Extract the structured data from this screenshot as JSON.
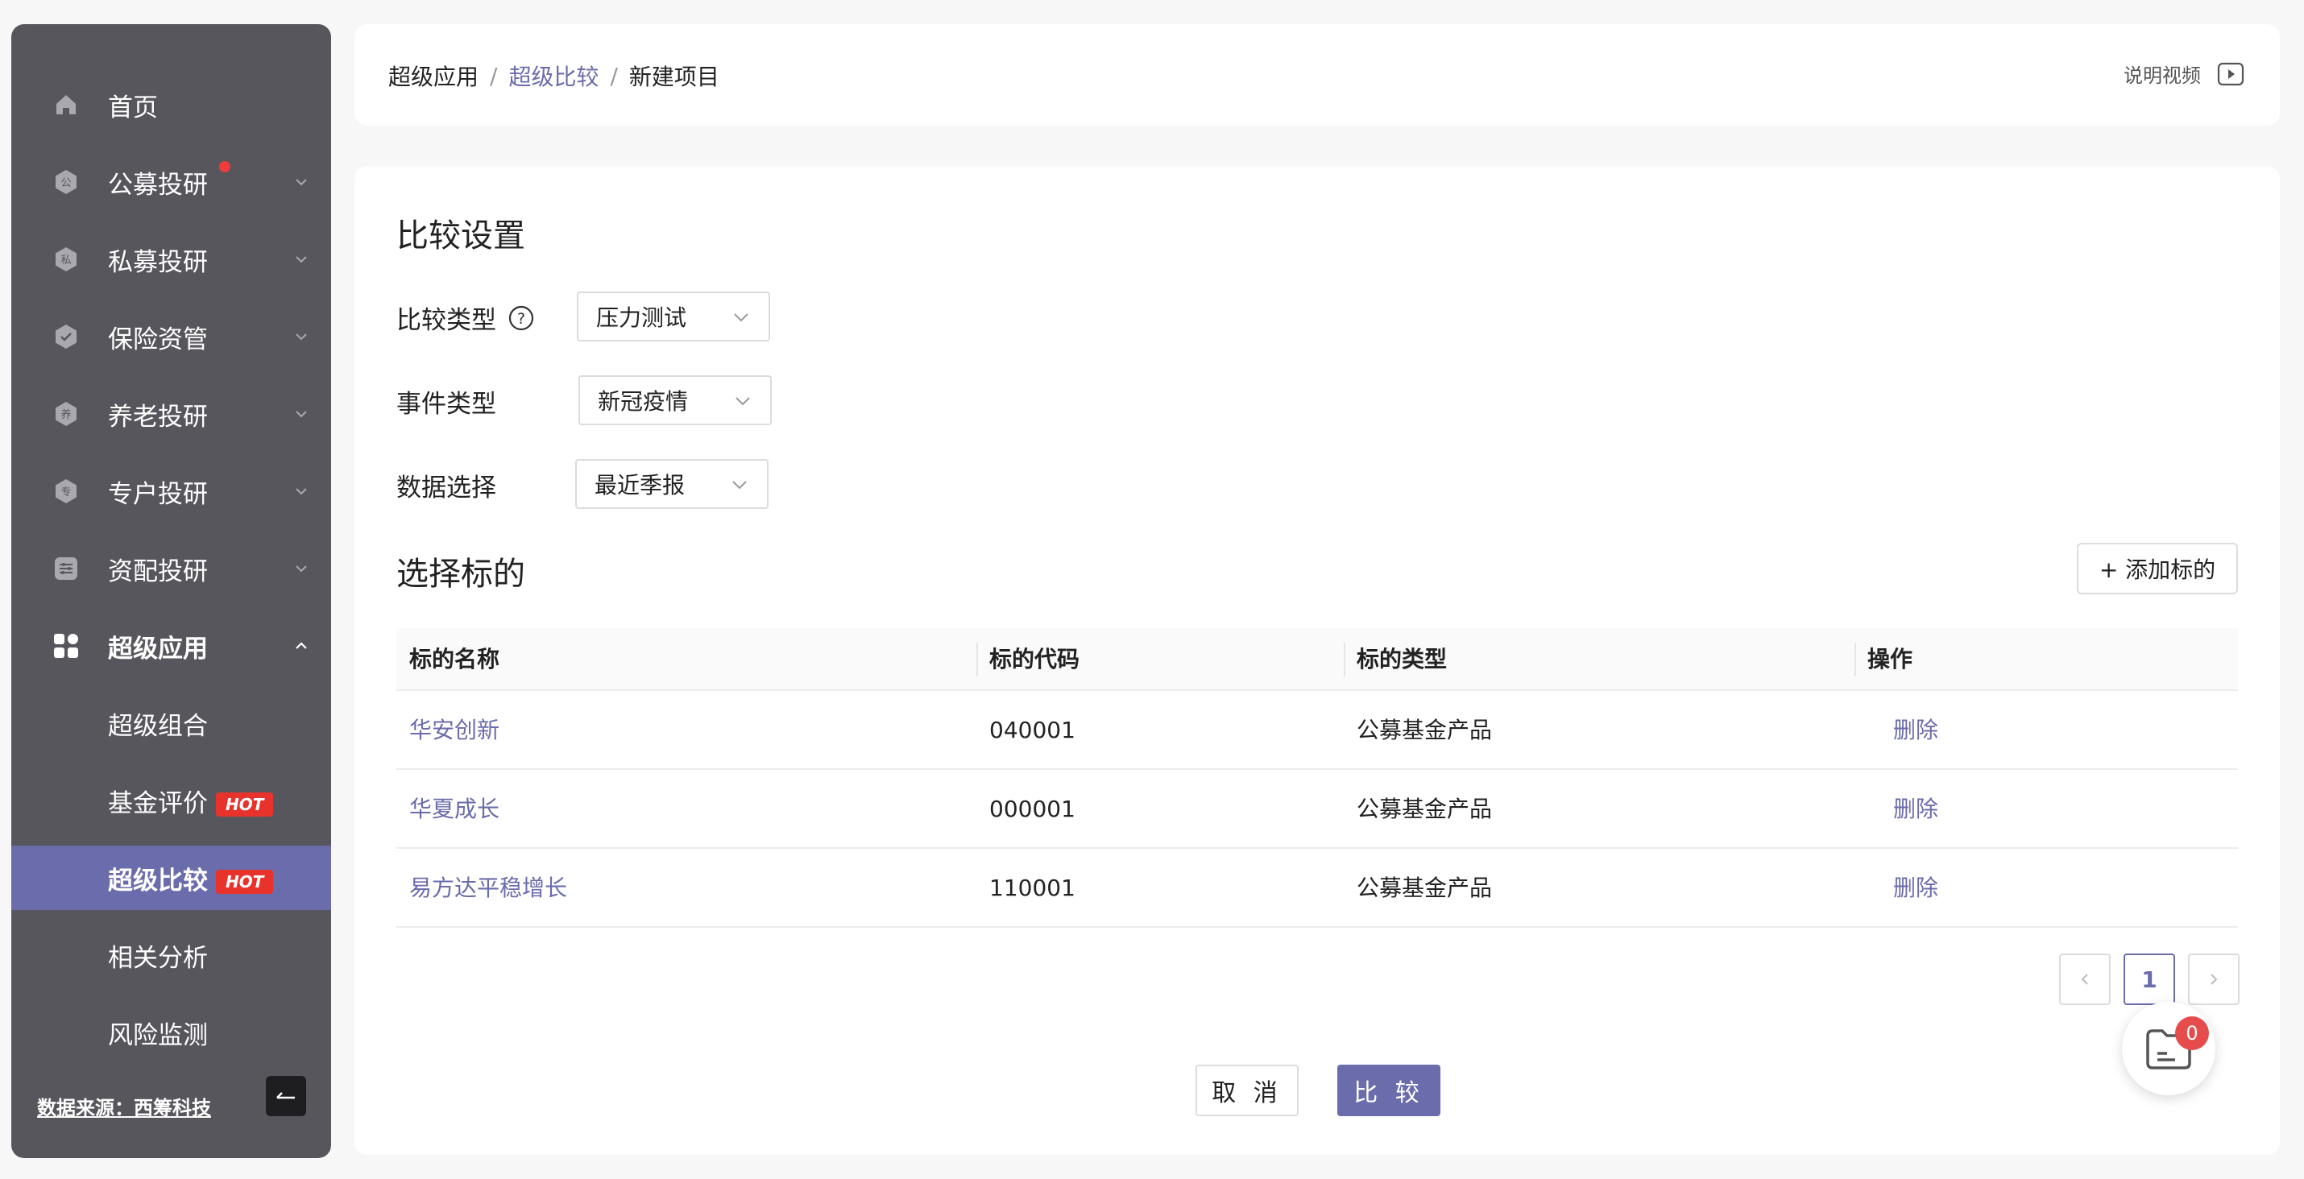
{
  "sidebar": {
    "items": [
      {
        "label": "首页",
        "icon": "home-icon"
      },
      {
        "label": "公募投研",
        "icon": "public-fund-icon",
        "badge_dot": true
      },
      {
        "label": "私募投研",
        "icon": "private-fund-icon"
      },
      {
        "label": "保险资管",
        "icon": "insurance-icon"
      },
      {
        "label": "养老投研",
        "icon": "pension-icon"
      },
      {
        "label": "专户投研",
        "icon": "special-account-icon"
      },
      {
        "label": "资配投研",
        "icon": "asset-allocation-icon"
      },
      {
        "label": "超级应用",
        "icon": "apps-grid-icon",
        "expanded": true
      },
      {
        "label": "超级组合"
      },
      {
        "label": "基金评价",
        "tag": "HOT"
      },
      {
        "label": "超级比较",
        "tag": "HOT",
        "active": true
      },
      {
        "label": "相关分析"
      },
      {
        "label": "风险监测"
      }
    ],
    "source": "数据来源：西筹科技",
    "accent_color": "#6a6cab"
  },
  "header": {
    "breadcrumb": [
      "超级应用",
      "超级比较",
      "新建项目"
    ],
    "separator": "/",
    "help_video": "说明视频"
  },
  "settings": {
    "title": "比较设置",
    "fields": [
      {
        "label": "比较类型",
        "value": "压力测试",
        "has_help": true
      },
      {
        "label": "事件类型",
        "value": "新冠疫情"
      },
      {
        "label": "数据选择",
        "value": "最近季报"
      }
    ]
  },
  "targets": {
    "title": "选择标的",
    "add_button": "+ 添加标的",
    "columns": [
      "标的名称",
      "标的代码",
      "标的类型",
      "操作"
    ],
    "rows": [
      {
        "name": "华安创新",
        "code": "040001",
        "type": "公募基金产品",
        "action": "删除"
      },
      {
        "name": "华夏成长",
        "code": "000001",
        "type": "公募基金产品",
        "action": "删除"
      },
      {
        "name": "易方达平稳增长",
        "code": "110001",
        "type": "公募基金产品",
        "action": "删除"
      }
    ]
  },
  "pagination": {
    "prev": "<",
    "current": "1",
    "next": ">"
  },
  "footer": {
    "cancel": "取 消",
    "compare": "比 较"
  },
  "basket": {
    "count": "0"
  }
}
